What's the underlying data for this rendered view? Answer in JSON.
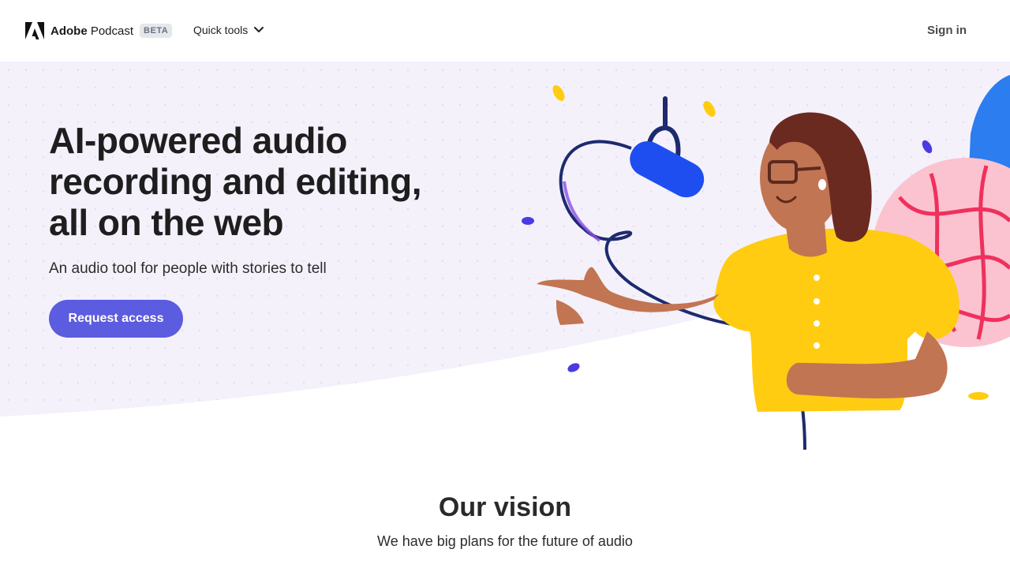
{
  "header": {
    "brand_name": "Adobe Podcast",
    "brand_name_bold": "Adobe",
    "brand_name_rest": " Podcast",
    "beta_badge": "BETA",
    "quick_tools_label": "Quick tools",
    "sign_in_label": "Sign in"
  },
  "hero": {
    "title_lines": [
      "AI-powered audio",
      "recording and editing,",
      "all on the web"
    ],
    "subtitle": "An audio tool for people with stories to tell",
    "cta_label": "Request access"
  },
  "vision": {
    "title": "Our vision",
    "subtitle": "We have big plans for the future of audio"
  },
  "icons": {
    "logo": "adobe-logo-icon",
    "dropdown": "chevron-down-icon"
  },
  "colors": {
    "hero_background": "#f4f1fb",
    "cta_background": "#5c5ce0",
    "shirt_yellow": "#ffcc12",
    "mic_blue": "#1f4ef0"
  }
}
